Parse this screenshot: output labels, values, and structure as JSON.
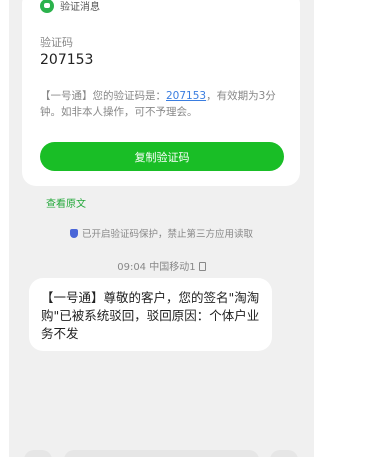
{
  "card": {
    "tag_label": "验证消息",
    "code_label": "验证码",
    "code_value": "207153",
    "sms_prefix": "【一号通】您的验证码是：",
    "sms_code_link": "207153",
    "sms_suffix": "，有效期为3分钟。如非本人操作，可不予理会。",
    "copy_button": "复制验证码"
  },
  "view_original": "查看原文",
  "protection_notice": "已开启验证码保护，禁止第三方应用读取",
  "timestamp": "09:04 中国移动1",
  "message": "【一号通】尊敬的客户，您的签名\"淘淘购\"已被系统驳回，驳回原因：个体户业务不发",
  "colors": {
    "accent_green": "#19be26",
    "link_blue": "#3a7de0"
  }
}
